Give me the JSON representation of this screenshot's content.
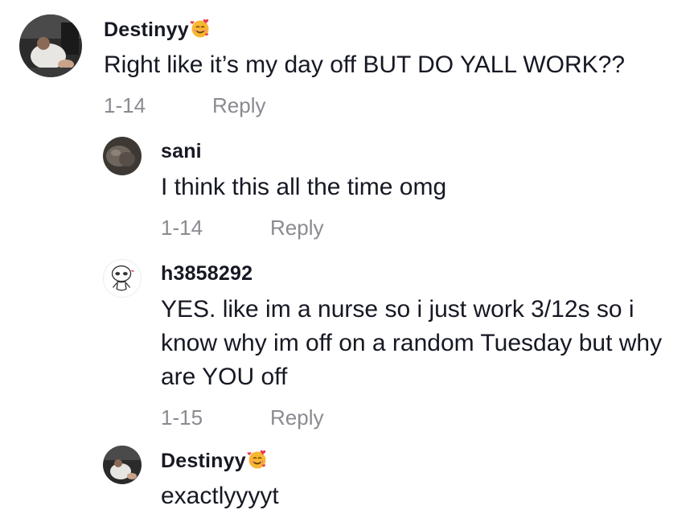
{
  "comments": [
    {
      "username": "Destinyy",
      "username_emoji": "smiling-face-with-hearts-icon",
      "text": "Right like it’s my day off BUT DO YALL WORK??",
      "date": "1-14",
      "reply_label": "Reply"
    },
    {
      "username": "sani",
      "text": "I think this all the time omg",
      "date": "1-14",
      "reply_label": "Reply"
    },
    {
      "username": "h3858292",
      "text": "YES. like im a nurse so i just work 3/12s so i know why im off on a random Tuesday but why are YOU off",
      "date": "1-15",
      "reply_label": "Reply"
    },
    {
      "username": "Destinyy",
      "username_emoji": "smiling-face-with-hearts-icon",
      "text": "exactlyyyyt"
    }
  ],
  "colors": {
    "username": "#161823",
    "text": "#161823",
    "meta": "#8a8b91",
    "background": "#ffffff"
  }
}
